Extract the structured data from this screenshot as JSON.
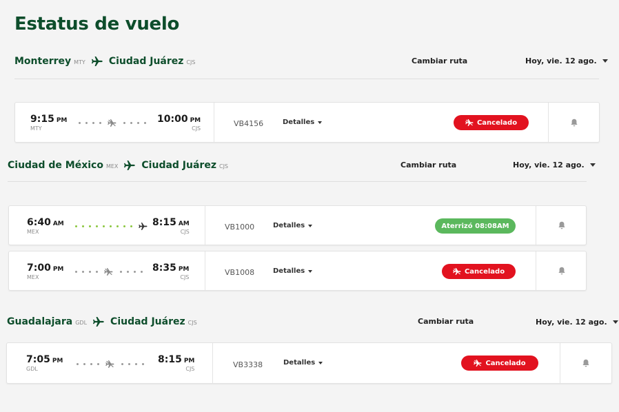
{
  "page": {
    "title": "Estatus de vuelo"
  },
  "colors": {
    "brand": "#0d4d2b",
    "cancel": "#e2121f",
    "arrived": "#5bb85d"
  },
  "routes": [
    {
      "origin": {
        "city": "Monterrey",
        "code": "MTY"
      },
      "destination": {
        "city": "Ciudad Juárez",
        "code": "CJS"
      },
      "change_route": "Cambiar ruta",
      "date": "Hoy, vie. 12 ago.",
      "flights": [
        {
          "dep_time": "9:15",
          "dep_ampm": "PM",
          "dep_code": "MTY",
          "arr_time": "10:00",
          "arr_ampm": "PM",
          "arr_code": "CJS",
          "flight_number": "VB4156",
          "details": "Detalles",
          "status": "Cancelado",
          "status_type": "cancelled",
          "status_icon": "plane-cancelled-icon"
        }
      ]
    },
    {
      "origin": {
        "city": "Ciudad de México",
        "code": "MEX"
      },
      "destination": {
        "city": "Ciudad Juárez",
        "code": "CJS"
      },
      "change_route": "Cambiar ruta",
      "date": "Hoy, vie. 12 ago.",
      "flights": [
        {
          "dep_time": "6:40",
          "dep_ampm": "AM",
          "dep_code": "MEX",
          "arr_time": "8:15",
          "arr_ampm": "AM",
          "arr_code": "CJS",
          "flight_number": "VB1000",
          "details": "Detalles",
          "status": "Aterrizó 08:08AM",
          "status_type": "landed",
          "status_icon": ""
        },
        {
          "dep_time": "7:00",
          "dep_ampm": "PM",
          "dep_code": "MEX",
          "arr_time": "8:35",
          "arr_ampm": "PM",
          "arr_code": "CJS",
          "flight_number": "VB1008",
          "details": "Detalles",
          "status": "Cancelado",
          "status_type": "cancelled",
          "status_icon": "plane-cancelled-icon"
        }
      ]
    },
    {
      "origin": {
        "city": "Guadalajara",
        "code": "GDL"
      },
      "destination": {
        "city": "Ciudad Juárez",
        "code": "CJS"
      },
      "change_route": "Cambiar ruta",
      "date": "Hoy, vie. 12 ago.",
      "flights": [
        {
          "dep_time": "7:05",
          "dep_ampm": "PM",
          "dep_code": "GDL",
          "arr_time": "8:15",
          "arr_ampm": "PM",
          "arr_code": "CJS",
          "flight_number": "VB3338",
          "details": "Detalles",
          "status": "Cancelado",
          "status_type": "cancelled",
          "status_icon": "plane-cancelled-icon"
        }
      ]
    }
  ]
}
